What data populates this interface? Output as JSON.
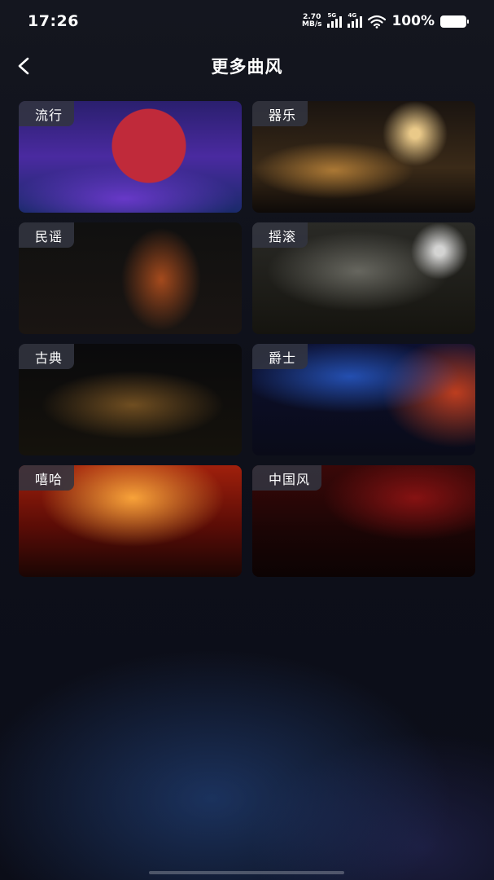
{
  "status_bar": {
    "time": "17:26",
    "net_speed_value": "2.70",
    "net_speed_unit": "MB/s",
    "sim1_label": "5G",
    "sim2_label": "4G",
    "battery_percent": "100%"
  },
  "header": {
    "back_icon": "chevron-left-icon",
    "title": "更多曲风"
  },
  "genres": [
    {
      "label": "流行"
    },
    {
      "label": "器乐"
    },
    {
      "label": "民谣"
    },
    {
      "label": "摇滚"
    },
    {
      "label": "古典"
    },
    {
      "label": "爵士"
    },
    {
      "label": "嘻哈"
    },
    {
      "label": "中国风"
    }
  ],
  "colors": {
    "background": "#0d0f1a",
    "label_background": "#323440",
    "text": "#ffffff"
  }
}
